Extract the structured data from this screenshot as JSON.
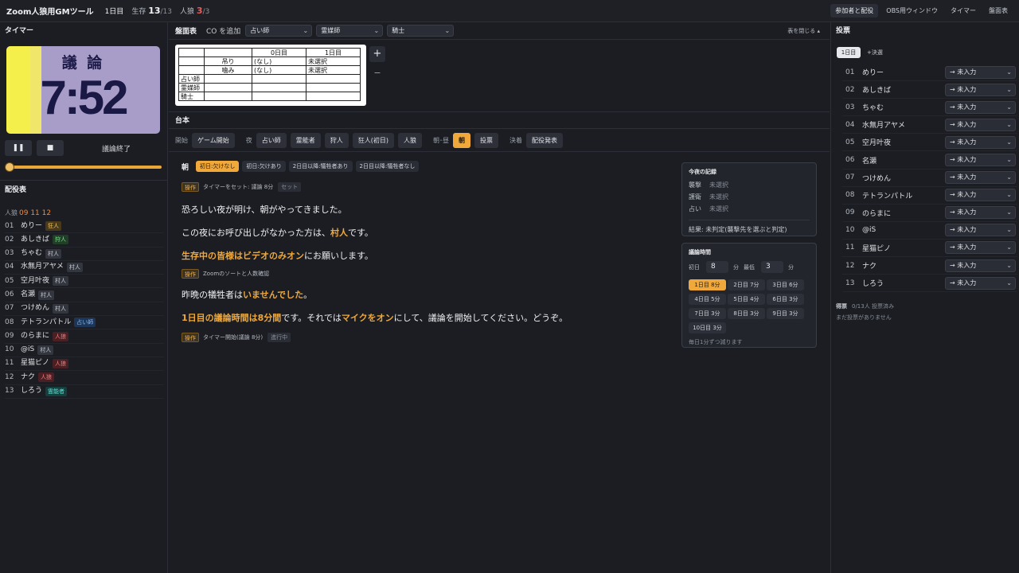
{
  "topbar": {
    "app_title": "Zoom人狼用GMツール",
    "day": "1日目",
    "alive_label": "生存",
    "alive_count": "13",
    "alive_total": "/13",
    "wolf_label": "人狼",
    "wolf_count": "3",
    "wolf_total": "/3",
    "btn_participants": "参加者と配役",
    "btn_obs": "OBS用ウィンドウ",
    "btn_timer": "タイマー",
    "btn_board": "盤面表"
  },
  "timer": {
    "heading": "タイマー",
    "phase_label": "議 論",
    "time": "7:52",
    "pause_icon": "❚❚",
    "stop_icon": "■",
    "end_label": "議論終了",
    "progress_fraction": 1.0
  },
  "cast": {
    "heading": "配役表",
    "wolf_prefix": "人狼",
    "wolf_numbers": "09  11  12",
    "players": [
      {
        "num": "01",
        "name": "めりー",
        "role": "狂人",
        "cls": "mad"
      },
      {
        "num": "02",
        "name": "あしきば",
        "role": "狩人",
        "cls": "hunter"
      },
      {
        "num": "03",
        "name": "ちゃむ",
        "role": "村人",
        "cls": "villager"
      },
      {
        "num": "04",
        "name": "水無月アヤメ",
        "role": "村人",
        "cls": "villager"
      },
      {
        "num": "05",
        "name": "空月叶夜",
        "role": "村人",
        "cls": "villager"
      },
      {
        "num": "06",
        "name": "名瀬",
        "role": "村人",
        "cls": "villager"
      },
      {
        "num": "07",
        "name": "つけめん",
        "role": "村人",
        "cls": "villager"
      },
      {
        "num": "08",
        "name": "テトランパトル",
        "role": "占い師",
        "cls": "seer"
      },
      {
        "num": "09",
        "name": "のらまに",
        "role": "人狼",
        "cls": "wolf"
      },
      {
        "num": "10",
        "name": "@iS",
        "role": "村人",
        "cls": "villager"
      },
      {
        "num": "11",
        "name": "星猫ピノ",
        "role": "人狼",
        "cls": "wolf"
      },
      {
        "num": "12",
        "name": "ナク",
        "role": "人狼",
        "cls": "wolf"
      },
      {
        "num": "13",
        "name": "しろう",
        "role": "霊能者",
        "cls": "medium"
      }
    ]
  },
  "board": {
    "heading": "盤面表",
    "co_label": "CO を追加",
    "select1": "占い師",
    "select2": "霊媒師",
    "select3": "騎士",
    "close_label": "表を閉じる ▴",
    "plus": "+",
    "minus": "−",
    "table": {
      "col0": "0日目",
      "col1": "1日目",
      "row_hang": "吊り",
      "row_bite": "噛み",
      "hang0": "(なし)",
      "hang1": "未選択",
      "bite0": "(なし)",
      "bite1": "未選択",
      "r_seer": "占い師",
      "r_medium": "霊媒師",
      "r_knight": "騎士"
    }
  },
  "script": {
    "heading": "台本",
    "grp_start": "開始",
    "btn_game_start": "ゲーム開始",
    "grp_night": "夜",
    "btn_seer": "占い師",
    "btn_medium": "霊能者",
    "btn_hunter": "狩人",
    "btn_mad": "狂人(初日)",
    "btn_wolf": "人狼",
    "grp_dayturn": "朝･昼",
    "btn_morning": "朝",
    "btn_vote": "投票",
    "grp_final": "決着",
    "btn_reveal": "配役発表",
    "morning_title": "朝",
    "chip1": "初日:欠けなし",
    "chip2": "初日:欠けあり",
    "chip3": "2日目以降:犠牲者あり",
    "chip4": "2日目以降:犠牲者なし",
    "op_badge": "操作",
    "op1_text": "タイマーをセット: 議論 8分",
    "op1_state": "セット",
    "op2_text": "Zoomのソートと人数確認",
    "op3_text": "タイマー開始(議論 8分)",
    "op3_state": "進行中",
    "line1": "恐ろしい夜が明け、朝がやってきました。",
    "line2_a": "この夜にお呼び出しがなかった方は、",
    "line2_b": "村人",
    "line2_c": "です。",
    "line3_a": "生存中の皆様はビデオのみオン",
    "line3_b": "にお願いします。",
    "line4_a": "昨晩の犠牲者は",
    "line4_b": "いませんでした",
    "line4_c": "。",
    "line5_a": "1日目の議論時間は8分間",
    "line5_b": "です。それでは",
    "line5_c": "マイクをオン",
    "line5_d": "にして、議論を開始してください。どうぞ。"
  },
  "night_record": {
    "title": "今夜の記録",
    "attack_label": "襲撃",
    "attack_value": "未選択",
    "guard_label": "護衛",
    "guard_value": "未選択",
    "divine_label": "占い",
    "divine_value": "未選択",
    "result": "結果: 未判定(襲撃先を選ぶと判定)"
  },
  "discussion": {
    "title": "議論時間",
    "first_label": "初日",
    "first_value": "8",
    "min_unit": "分",
    "min_label": "最低",
    "min_value": "3",
    "days": [
      "1日目 8分",
      "2日目 7分",
      "3日目 6分",
      "4日目 5分",
      "5日目 4分",
      "6日目 3分",
      "7日目 3分",
      "8日目 3分",
      "9日目 3分",
      "10日目 3分"
    ],
    "note": "毎日1分ずつ減ります"
  },
  "vote": {
    "heading": "投票",
    "day_tab": "1日目",
    "new_vote": "+決選",
    "select_text": "→ 未入力",
    "players": [
      {
        "num": "01",
        "name": "めりー"
      },
      {
        "num": "02",
        "name": "あしきば"
      },
      {
        "num": "03",
        "name": "ちゃむ"
      },
      {
        "num": "04",
        "name": "水無月アヤメ"
      },
      {
        "num": "05",
        "name": "空月叶夜"
      },
      {
        "num": "06",
        "name": "名瀬"
      },
      {
        "num": "07",
        "name": "つけめん"
      },
      {
        "num": "08",
        "name": "テトランパトル"
      },
      {
        "num": "09",
        "name": "のらまに"
      },
      {
        "num": "10",
        "name": "@iS"
      },
      {
        "num": "11",
        "name": "星猫ピノ"
      },
      {
        "num": "12",
        "name": "ナク"
      },
      {
        "num": "13",
        "name": "しろう"
      }
    ],
    "tally_label": "得票",
    "tally_count": "0/13人 投票済み",
    "no_votes": "まだ投票がありません"
  }
}
